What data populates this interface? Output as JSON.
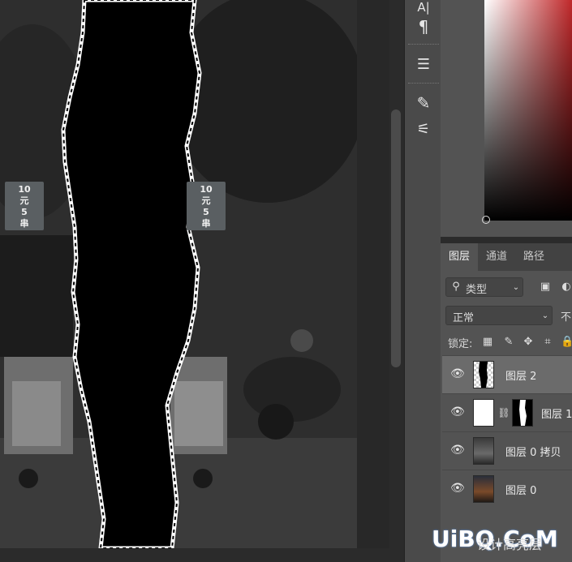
{
  "canvas": {
    "signs": [
      {
        "line1": "10",
        "line2": "元",
        "line3": "5",
        "line4": "串"
      },
      {
        "line1": "10",
        "line2": "元",
        "line3": "5",
        "line4": "串"
      }
    ]
  },
  "toolbar": {
    "tools": [
      {
        "icon": "character-icon",
        "glyph": "A|"
      },
      {
        "icon": "paragraph-icon",
        "glyph": "¶"
      },
      {
        "icon": "adjustments-icon",
        "glyph": "☰"
      },
      {
        "icon": "brush-settings-icon",
        "glyph": "✎"
      },
      {
        "icon": "brush-presets-icon",
        "glyph": "⚟"
      }
    ]
  },
  "panels": {
    "tabs": [
      {
        "label": "图层",
        "active": true
      },
      {
        "label": "通道",
        "active": false
      },
      {
        "label": "路径",
        "active": false
      }
    ],
    "filter": {
      "label": "类型"
    },
    "blend_mode": {
      "label": "正常",
      "opacity_label": "不"
    },
    "lock": {
      "label": "锁定:"
    }
  },
  "layers": [
    {
      "name": "图层 2",
      "selected": true,
      "visible": true
    },
    {
      "name": "图层 1",
      "selected": false,
      "visible": true
    },
    {
      "name": "图层 0 拷贝",
      "selected": false,
      "visible": true
    },
    {
      "name": "图层 0",
      "selected": false,
      "visible": true
    }
  ],
  "watermark": {
    "text": "UiBQ.CoM",
    "sub": "设计高亮层"
  },
  "colors": {
    "accent_red": "#c0282a",
    "panel_bg": "#535353",
    "selected_layer": "#6b6b6b"
  }
}
